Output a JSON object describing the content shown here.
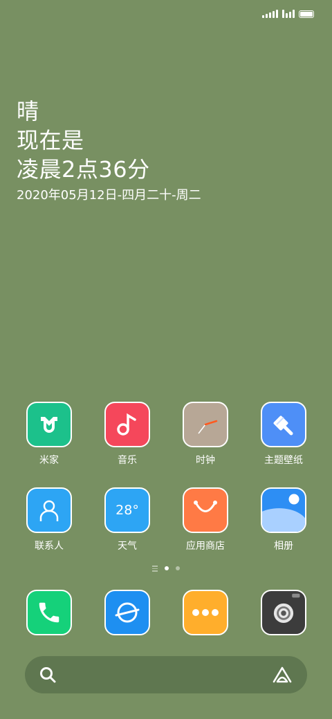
{
  "weather": {
    "line1": "晴",
    "line2": "现在是",
    "line3": "凌晨2点36分",
    "date": "2020年05月12日-四月二十-周二"
  },
  "apps": [
    {
      "label": "米家",
      "icon": "mi-home-icon",
      "color": "#1cc18b"
    },
    {
      "label": "音乐",
      "icon": "music-icon",
      "color": "#f5475b"
    },
    {
      "label": "时钟",
      "icon": "clock-icon",
      "color": "#b7a796"
    },
    {
      "label": "主题壁纸",
      "icon": "brush-icon",
      "color": "#4e8ff7"
    },
    {
      "label": "联系人",
      "icon": "contact-icon",
      "color": "#2da5f4"
    },
    {
      "label": "天气",
      "icon": "weather-icon",
      "color": "#2da5f4",
      "temp": "28°"
    },
    {
      "label": "应用商店",
      "icon": "shopping-bag-icon",
      "color": "#ff7a45"
    },
    {
      "label": "相册",
      "icon": "gallery-icon",
      "color": "#2d8ef4"
    }
  ],
  "dock": [
    {
      "icon": "phone-icon",
      "color": "#15d17a"
    },
    {
      "icon": "browser-icon",
      "color": "#1e8ff1"
    },
    {
      "icon": "messages-icon",
      "color": "#ffae2c"
    },
    {
      "icon": "camera-icon",
      "color": "#3c3c3c"
    }
  ],
  "colors": {
    "wallpaper": "#789062",
    "search_bar": "#5f7750"
  }
}
